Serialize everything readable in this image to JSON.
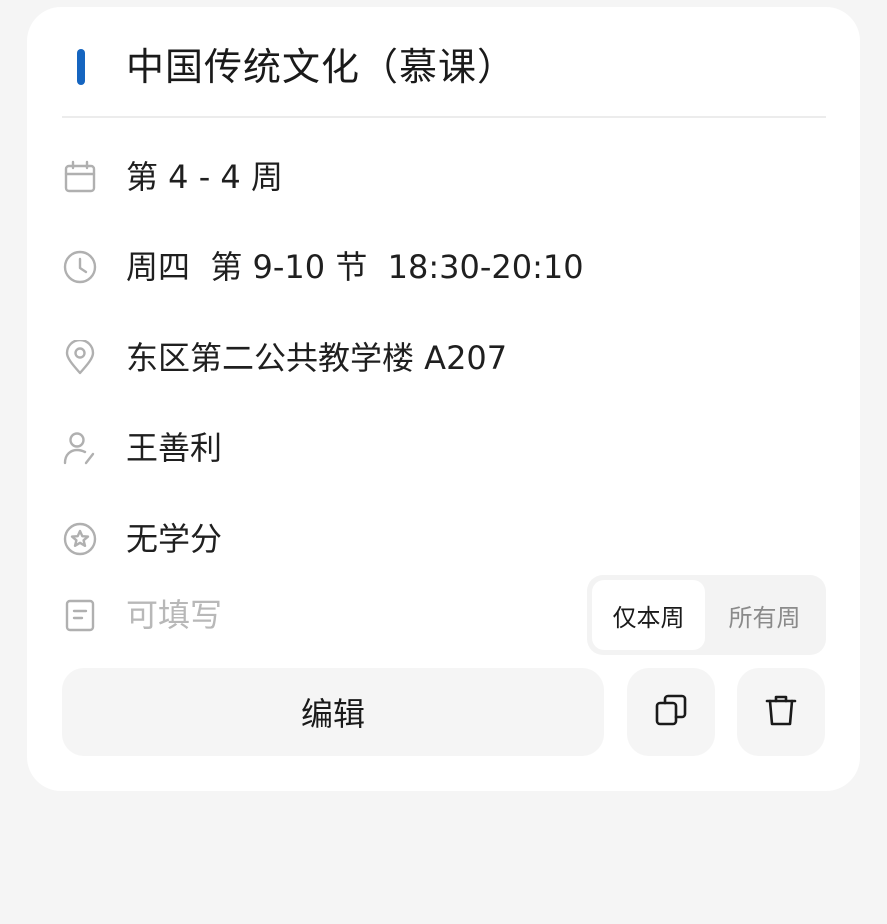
{
  "course": {
    "title": "中国传统文化（慕课）",
    "accent_color": "#1565c0"
  },
  "details": {
    "weeks": "第 4 - 4 周",
    "time": "周四  第 9-10 节  18:30-20:10",
    "location": "东区第二公共教学楼 A207",
    "teacher": "王善利",
    "credits": "无学分",
    "note_placeholder": "可填写"
  },
  "icons": {
    "weeks": "calendar-icon",
    "time": "clock-icon",
    "location": "location-pin-icon",
    "teacher": "person-edit-icon",
    "credits": "star-badge-icon",
    "note": "note-icon",
    "copy": "copy-icon",
    "delete": "trash-icon"
  },
  "scope_toggle": {
    "options": [
      "仅本周",
      "所有周"
    ],
    "selected": "仅本周"
  },
  "actions": {
    "edit_label": "编辑"
  }
}
